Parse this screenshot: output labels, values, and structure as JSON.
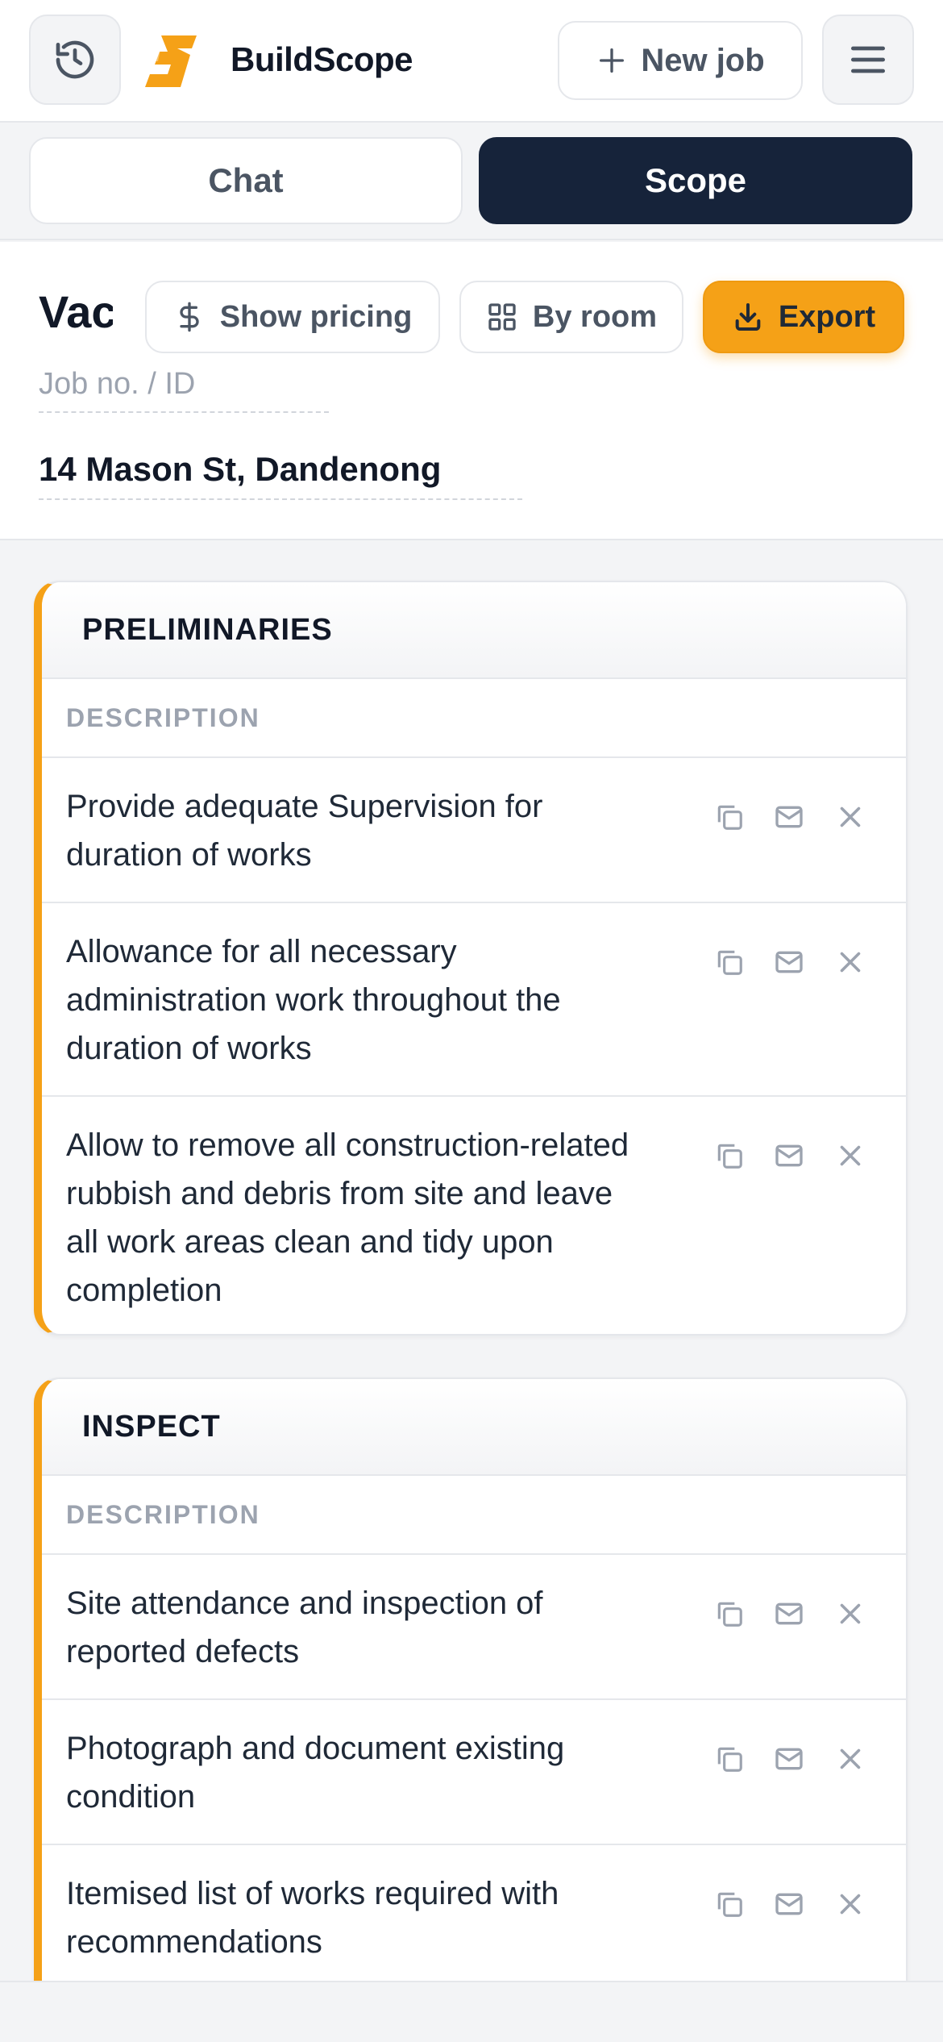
{
  "header": {
    "brand": "BuildScope",
    "new_job_label": "New job",
    "icons": {
      "history": "history-icon",
      "menu": "hamburger-menu-icon",
      "logo": "buildscope-logo"
    },
    "accent_color": "#f5a117"
  },
  "tabs": [
    {
      "label": "Chat",
      "active": false
    },
    {
      "label": "Scope",
      "active": true
    }
  ],
  "job": {
    "title": "Vac",
    "job_no_placeholder": "Job no. / ID",
    "address": "14 Mason St, Dandenong"
  },
  "toolbar": {
    "show_pricing_label": "Show pricing",
    "by_room_label": "By room",
    "export_label": "Export"
  },
  "sections": [
    {
      "title": "PRELIMINARIES",
      "column_header": "DESCRIPTION",
      "items": [
        "Provide adequate Supervision for duration of works",
        "Allowance for all necessary administration work throughout the duration of works",
        "Allow to remove all construction-related rubbish and debris from site and leave all work areas clean and tidy upon completion"
      ]
    },
    {
      "title": "INSPECT",
      "column_header": "DESCRIPTION",
      "items": [
        "Site attendance and inspection of reported defects",
        "Photograph and document existing condition",
        "Itemised list of works required with recommendations"
      ]
    }
  ],
  "row_action_icons": [
    "copy-icon",
    "mail-icon",
    "close-icon"
  ]
}
